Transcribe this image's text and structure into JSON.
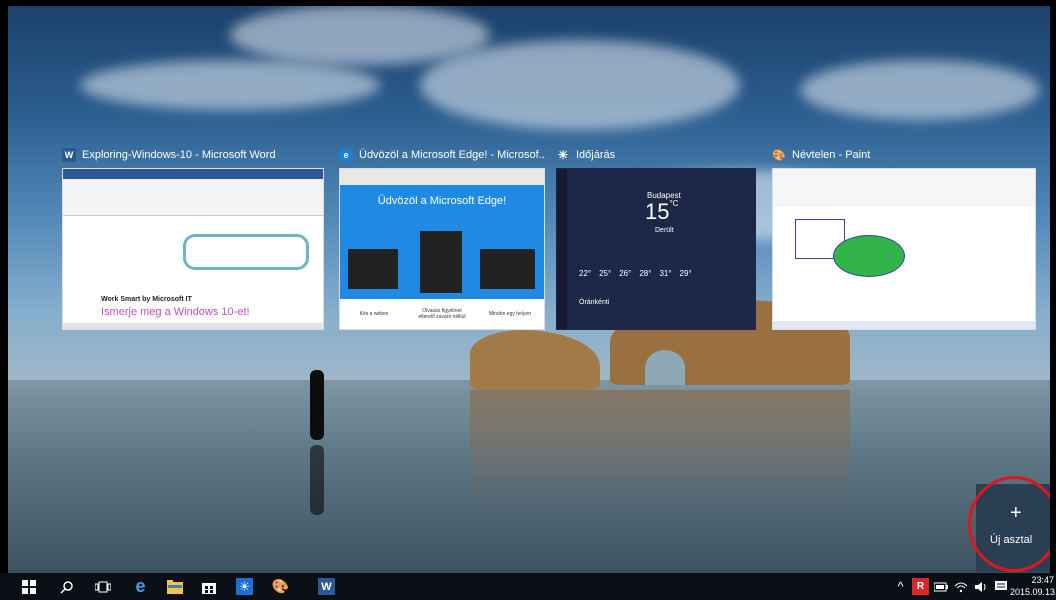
{
  "windows": [
    {
      "title": "Exploring-Windows-10 - Microsoft Word",
      "icon": "word-icon",
      "icon_color": "#2b5797",
      "icon_glyph": "W",
      "doc_text": "Work Smart by Microsoft IT",
      "doc_heading": "Ismerje meg a Windows 10-et!"
    },
    {
      "title": "Üdvözöl a Microsoft Edge! - Microsof...",
      "icon": "edge-icon",
      "icon_color": "#1c7fd9",
      "icon_glyph": "e",
      "heading": "Üdvözöl a Microsoft Edge!",
      "captions": [
        "Kés a webes",
        "Olvasás figyelmet elterelő zavaró nélkül",
        "Minden egy helyen"
      ]
    },
    {
      "title": "Időjárás",
      "icon": "weather-icon",
      "icon_color": "#ffffff",
      "icon_glyph": "☀",
      "city": "Budapest",
      "temp": "15",
      "unit": "°C",
      "condition": "Derült",
      "forecast": [
        "22°",
        "25°",
        "26°",
        "28°",
        "31°",
        "29°"
      ],
      "section": "Óránkénti"
    },
    {
      "title": "Névtelen - Paint",
      "icon": "paint-icon",
      "icon_color": "#ffffff",
      "icon_glyph": "🎨"
    }
  ],
  "new_desktop": {
    "label": "Új asztal",
    "plus": "+"
  },
  "taskbar": {
    "time": "23:47",
    "date": "2015.09.13."
  },
  "colors": {
    "taskbar": "#0b0f16",
    "accent_red": "#e0161d",
    "word_blue": "#2b5797",
    "edge_blue": "#1f8ae4",
    "weather_navy": "#1d2747"
  }
}
